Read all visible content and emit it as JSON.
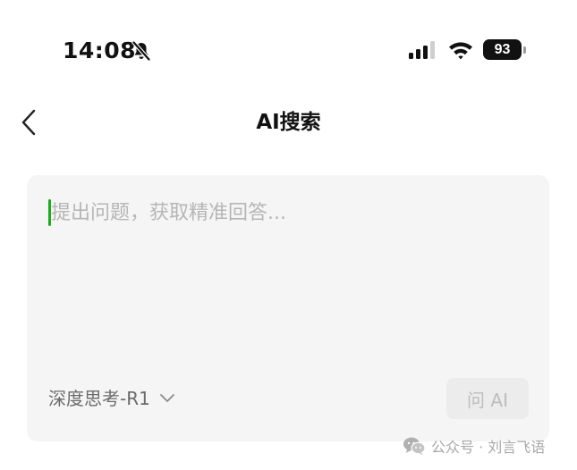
{
  "status_bar": {
    "time": "14:08",
    "battery_level": "93",
    "icons": [
      "bell-slash-icon",
      "cellular-signal-icon",
      "wifi-icon",
      "battery-icon"
    ]
  },
  "nav": {
    "back_icon": "chevron-left-icon",
    "title": "AI搜索"
  },
  "search": {
    "placeholder": "提出问题，获取精准回答...",
    "value": "",
    "model_label": "深度思考-R1",
    "model_dropdown_icon": "chevron-down-icon",
    "ask_button_label": "问 AI"
  },
  "watermark": {
    "icon": "wechat-icon",
    "text": "公众号 · 刘言飞语"
  },
  "colors": {
    "caret": "#1aad19",
    "card_background": "#f5f5f5",
    "placeholder": "#b6b6b6",
    "button_disabled_bg": "#ececec",
    "button_disabled_text": "#bdbdbd"
  }
}
